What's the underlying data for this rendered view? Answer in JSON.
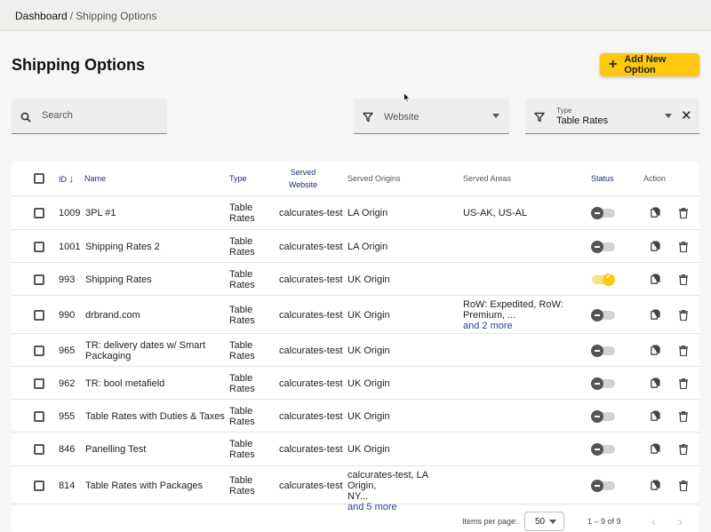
{
  "breadcrumb": {
    "root": "Dashboard",
    "separator": "/",
    "current": "Shipping Options"
  },
  "page_title": "Shipping Options",
  "add_button": {
    "icon": "plus-icon",
    "label": "Add New Option"
  },
  "filters": {
    "search": {
      "placeholder": "Search",
      "value": "",
      "icon": "search-icon"
    },
    "website": {
      "label": "Website",
      "icon": "filter-icon"
    },
    "type": {
      "label": "Type",
      "value": "Table Rates",
      "icon": "filter-icon",
      "clear_icon": "close-icon"
    }
  },
  "table": {
    "headers": {
      "id": "ID",
      "name": "Name",
      "type": "Type",
      "served_website_1": "Served",
      "served_website_2": "Website",
      "served_origins": "Served Origins",
      "served_areas": "Served Areas",
      "status": "Status",
      "action": "Action"
    },
    "sort": {
      "column": "id",
      "direction": "descending"
    },
    "rows": [
      {
        "id": "1009",
        "name": "3PL #1",
        "type_1": "Table",
        "type_2": "Rates",
        "website": "calcurates-test",
        "origins_1": "LA Origin",
        "origins_2": "",
        "origins_more": "",
        "areas_1": "US-AK, US-AL",
        "areas_2": "",
        "areas_more": "",
        "status": "off"
      },
      {
        "id": "1001",
        "name": "Shipping Rates 2",
        "type_1": "Table",
        "type_2": "Rates",
        "website": "calcurates-test",
        "origins_1": "LA Origin",
        "origins_2": "",
        "origins_more": "",
        "areas_1": "",
        "areas_2": "",
        "areas_more": "",
        "status": "off"
      },
      {
        "id": "993",
        "name": "Shipping Rates",
        "type_1": "Table",
        "type_2": "Rates",
        "website": "calcurates-test",
        "origins_1": "UK Origin",
        "origins_2": "",
        "origins_more": "",
        "areas_1": "",
        "areas_2": "",
        "areas_more": "",
        "status": "on"
      },
      {
        "id": "990",
        "name": "drbrand.com",
        "type_1": "Table",
        "type_2": "Rates",
        "website": "calcurates-test",
        "origins_1": "UK Origin",
        "origins_2": "",
        "origins_more": "",
        "areas_1": "RoW: Expedited, RoW:",
        "areas_2": "Premium, ...",
        "areas_more": "and 2 more",
        "status": "off"
      },
      {
        "id": "965",
        "name": "TR: delivery dates w/ Smart",
        "name_2": "Packaging",
        "type_1": "Table",
        "type_2": "Rates",
        "website": "calcurates-test",
        "origins_1": "UK Origin",
        "origins_2": "",
        "origins_more": "",
        "areas_1": "",
        "areas_2": "",
        "areas_more": "",
        "status": "off"
      },
      {
        "id": "962",
        "name": "TR: bool metafield",
        "type_1": "Table",
        "type_2": "Rates",
        "website": "calcurates-test",
        "origins_1": "UK Origin",
        "origins_2": "",
        "origins_more": "",
        "areas_1": "",
        "areas_2": "",
        "areas_more": "",
        "status": "off"
      },
      {
        "id": "955",
        "name": "Table Rates with Duties & Taxes",
        "type_1": "Table",
        "type_2": "Rates",
        "website": "calcurates-test",
        "origins_1": "UK Origin",
        "origins_2": "",
        "origins_more": "",
        "areas_1": "",
        "areas_2": "",
        "areas_more": "",
        "status": "off"
      },
      {
        "id": "846",
        "name": "Panelling Test",
        "type_1": "Table",
        "type_2": "Rates",
        "website": "calcurates-test",
        "origins_1": "UK Origin",
        "origins_2": "",
        "origins_more": "",
        "areas_1": "",
        "areas_2": "",
        "areas_more": "",
        "status": "off"
      },
      {
        "id": "814",
        "name": "Table Rates with Packages",
        "type_1": "Table",
        "type_2": "Rates",
        "website": "calcurates-test",
        "origins_1": "calcurates-test, LA Origin,",
        "origins_2": "NY...",
        "origins_more": "and 5 more",
        "areas_1": "",
        "areas_2": "",
        "areas_more": "",
        "status": "off"
      }
    ],
    "row_actions": {
      "copy_icon": "copy-icon",
      "delete_icon": "trash-icon"
    }
  },
  "paginator": {
    "items_per_page_label": "Items per page:",
    "items_per_page_value": "50",
    "range_label": "1 – 9 of 9",
    "prev_icon": "chevron-left-icon",
    "next_icon": "chevron-right-icon"
  },
  "colors": {
    "accent": "#fdc80e",
    "header_link": "#1f2e6e",
    "more_link": "#2c3f9c",
    "background": "#f7f6f4"
  }
}
